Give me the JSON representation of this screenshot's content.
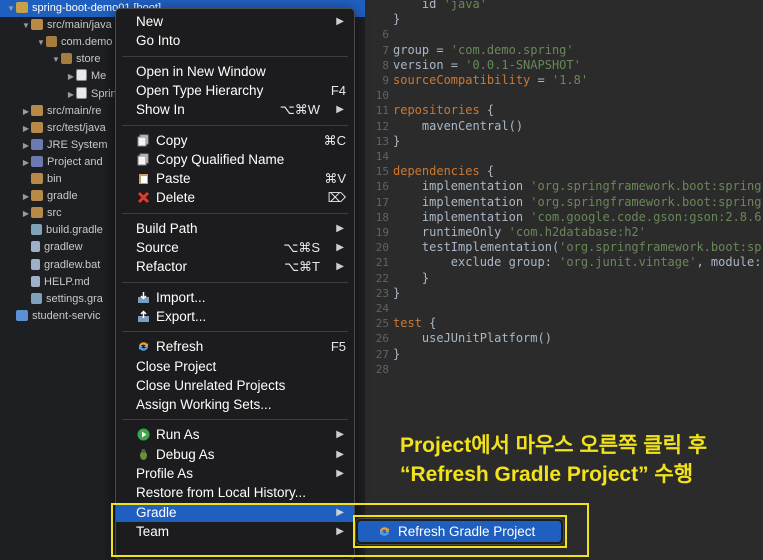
{
  "explorer": {
    "rows": [
      {
        "label": "spring-boot-demo01 [boot]",
        "depth": 0,
        "twisty": "▼",
        "icon": "proj",
        "selected": true
      },
      {
        "label": "src/main/java",
        "depth": 1,
        "twisty": "▼",
        "icon": "folder"
      },
      {
        "label": "com.demo",
        "depth": 2,
        "twisty": "▼",
        "icon": "pkg"
      },
      {
        "label": "store",
        "depth": 3,
        "twisty": "▼",
        "icon": "pkg"
      },
      {
        "label": "Me",
        "depth": 4,
        "twisty": "▶",
        "icon": "java"
      },
      {
        "label": "Spring",
        "depth": 4,
        "twisty": "▶",
        "icon": "java"
      },
      {
        "label": "src/main/re",
        "depth": 1,
        "twisty": "▶",
        "icon": "folder"
      },
      {
        "label": "src/test/java",
        "depth": 1,
        "twisty": "▶",
        "icon": "folder"
      },
      {
        "label": "JRE System",
        "depth": 1,
        "twisty": "▶",
        "icon": "lib"
      },
      {
        "label": "Project and",
        "depth": 1,
        "twisty": "▶",
        "icon": "lib"
      },
      {
        "label": "bin",
        "depth": 1,
        "twisty": "",
        "icon": "folder"
      },
      {
        "label": "gradle",
        "depth": 1,
        "twisty": "▶",
        "icon": "folder"
      },
      {
        "label": "src",
        "depth": 1,
        "twisty": "▶",
        "icon": "folder"
      },
      {
        "label": "build.gradle",
        "depth": 1,
        "twisty": "",
        "icon": "gradle"
      },
      {
        "label": "gradlew",
        "depth": 1,
        "twisty": "",
        "icon": "file"
      },
      {
        "label": "gradlew.bat",
        "depth": 1,
        "twisty": "",
        "icon": "file"
      },
      {
        "label": "HELP.md",
        "depth": 1,
        "twisty": "",
        "icon": "file"
      },
      {
        "label": "settings.gra",
        "depth": 1,
        "twisty": "",
        "icon": "gradle"
      },
      {
        "label": "student-servic",
        "depth": 0,
        "twisty": "",
        "icon": "svc"
      }
    ]
  },
  "editor": {
    "lines": [
      {
        "n": "",
        "t": [
          [
            "    id ",
            ""
          ],
          [
            "'java'",
            "s"
          ]
        ]
      },
      {
        "n": "",
        "t": [
          [
            "}",
            ""
          ]
        ]
      },
      {
        "n": "6",
        "t": []
      },
      {
        "n": "7",
        "t": [
          [
            "group = ",
            ""
          ],
          [
            "'com.demo.spring'",
            "s"
          ]
        ]
      },
      {
        "n": "8",
        "t": [
          [
            "version = ",
            ""
          ],
          [
            "'0.0.1-SNAPSHOT'",
            "s"
          ]
        ]
      },
      {
        "n": "9",
        "t": [
          [
            "sourceCompatibility",
            "k"
          ],
          [
            " = ",
            ""
          ],
          [
            "'1.8'",
            "s"
          ]
        ]
      },
      {
        "n": "10",
        "t": []
      },
      {
        "n": "11",
        "t": [
          [
            "repositories",
            "k"
          ],
          [
            " {",
            ""
          ]
        ]
      },
      {
        "n": "12",
        "t": [
          [
            "    mavenCentral()",
            ""
          ]
        ]
      },
      {
        "n": "13",
        "t": [
          [
            "}",
            ""
          ]
        ]
      },
      {
        "n": "14",
        "t": []
      },
      {
        "n": "15",
        "t": [
          [
            "dependencies",
            "k"
          ],
          [
            " {",
            ""
          ]
        ]
      },
      {
        "n": "16",
        "t": [
          [
            "    implementation ",
            ""
          ],
          [
            "'org.springframework.boot:spring-",
            "s"
          ]
        ]
      },
      {
        "n": "17",
        "t": [
          [
            "    implementation ",
            ""
          ],
          [
            "'org.springframework.boot:spring-",
            "s"
          ]
        ]
      },
      {
        "n": "18",
        "t": [
          [
            "    implementation ",
            ""
          ],
          [
            "'com.google.code.gson:gson:2.8.6",
            "s"
          ]
        ]
      },
      {
        "n": "19",
        "t": [
          [
            "    runtimeOnly ",
            ""
          ],
          [
            "'com.h2database:h2'",
            "s"
          ]
        ]
      },
      {
        "n": "20",
        "t": [
          [
            "    testImplementation(",
            ""
          ],
          [
            "'org.springframework.boot:spr",
            "s"
          ]
        ]
      },
      {
        "n": "21",
        "t": [
          [
            "        exclude group: ",
            ""
          ],
          [
            "'org.junit.vintage'",
            "s"
          ],
          [
            ", module:",
            ""
          ]
        ]
      },
      {
        "n": "22",
        "t": [
          [
            "    }",
            ""
          ]
        ]
      },
      {
        "n": "23",
        "t": [
          [
            "}",
            ""
          ]
        ]
      },
      {
        "n": "24",
        "t": []
      },
      {
        "n": "25",
        "t": [
          [
            "test",
            "k"
          ],
          [
            " {",
            ""
          ]
        ]
      },
      {
        "n": "26",
        "t": [
          [
            "    useJUnitPlatform()",
            ""
          ]
        ]
      },
      {
        "n": "27",
        "t": [
          [
            "}",
            ""
          ]
        ]
      },
      {
        "n": "28",
        "t": []
      }
    ]
  },
  "menu": {
    "items": [
      {
        "label": "New",
        "submenu": true
      },
      {
        "label": "Go Into"
      },
      {
        "sep": true
      },
      {
        "label": "Open in New Window"
      },
      {
        "label": "Open Type Hierarchy",
        "shortcut": "F4"
      },
      {
        "label": "Show In",
        "shortcut": "⌥⌘W",
        "submenu": true
      },
      {
        "sep": true
      },
      {
        "label": "Copy",
        "shortcut": "⌘C",
        "icon": "copy"
      },
      {
        "label": "Copy Qualified Name",
        "icon": "copy"
      },
      {
        "label": "Paste",
        "shortcut": "⌘V",
        "icon": "paste"
      },
      {
        "label": "Delete",
        "shortcut": "⌦",
        "icon": "delete"
      },
      {
        "sep": true
      },
      {
        "label": "Build Path",
        "submenu": true
      },
      {
        "label": "Source",
        "shortcut": "⌥⌘S",
        "submenu": true
      },
      {
        "label": "Refactor",
        "shortcut": "⌥⌘T",
        "submenu": true
      },
      {
        "sep": true
      },
      {
        "label": "Import...",
        "icon": "import"
      },
      {
        "label": "Export...",
        "icon": "export"
      },
      {
        "sep": true
      },
      {
        "label": "Refresh",
        "shortcut": "F5",
        "icon": "refresh"
      },
      {
        "label": "Close Project"
      },
      {
        "label": "Close Unrelated Projects"
      },
      {
        "label": "Assign Working Sets..."
      },
      {
        "sep": true
      },
      {
        "label": "Run As",
        "submenu": true,
        "icon": "run"
      },
      {
        "label": "Debug As",
        "submenu": true,
        "icon": "debug"
      },
      {
        "label": "Profile As",
        "submenu": true
      },
      {
        "label": "Restore from Local History..."
      },
      {
        "label": "Gradle",
        "submenu": true,
        "highlighted": true
      },
      {
        "label": "Team",
        "submenu": true
      }
    ]
  },
  "submenu": {
    "label": "Refresh Gradle Project"
  },
  "annotation": {
    "line1": "Project에서 마우스 오른쪽 클릭 후",
    "line2": "“Refresh Gradle Project” 수행"
  },
  "colors": {
    "annotation": "#f2e21c",
    "selection": "#1f5fbf"
  }
}
